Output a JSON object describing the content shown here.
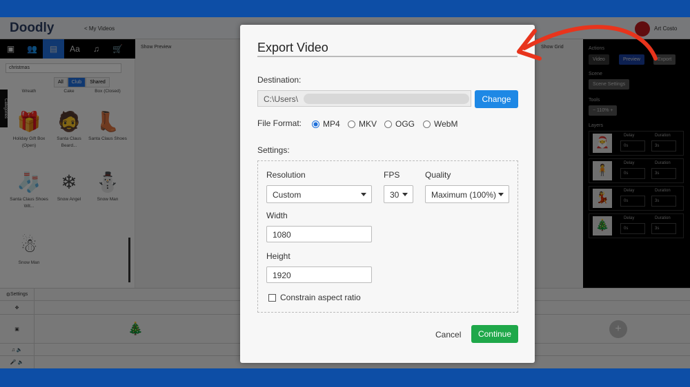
{
  "app": {
    "logo": "Doodly",
    "back_link": "< My Videos",
    "user_name": "Art Costo",
    "search_value": "christmas",
    "filters": [
      "All",
      "Club",
      "Shared"
    ],
    "categories_tab": "Categories",
    "show_preview": "Show Preview",
    "show_grid": "Show Grid",
    "assets": [
      {
        "label": "Wreath"
      },
      {
        "label": "Cake"
      },
      {
        "label": "Box (Closed)"
      },
      {
        "label": "Holiday Gift Box (Open)",
        "icon": "🎁"
      },
      {
        "label": "Santa Claus Beard...",
        "icon": "🧔"
      },
      {
        "label": "Santa Claus Shoes",
        "icon": "👢"
      },
      {
        "label": "Santa Claus Shoes Wit...",
        "icon": "🧦"
      },
      {
        "label": "Snow Angel",
        "icon": "❄"
      },
      {
        "label": "Snow Man",
        "icon": "⛄"
      },
      {
        "label": "Snow Man",
        "icon": "☃"
      }
    ],
    "right_panel": {
      "actions_label": "Actions",
      "video_select": "Video",
      "preview": "Preview",
      "export": "Export",
      "scene_label": "Scene",
      "scene_settings": "Scene Settings",
      "tools_label": "Tools",
      "zoom": "110%",
      "layers_label": "Layers",
      "delay_label": "Delay",
      "duration_label": "Duration",
      "layers": [
        {
          "delay": "0s",
          "duration": "3s"
        },
        {
          "delay": "0s",
          "duration": "3s"
        },
        {
          "delay": "0s",
          "duration": "3s"
        },
        {
          "delay": "0s",
          "duration": "3s"
        }
      ]
    },
    "timeline": {
      "settings": "Settings"
    }
  },
  "dialog": {
    "title": "Export Video",
    "destination_label": "Destination:",
    "destination_value": "C:\\Users\\",
    "change": "Change",
    "file_format_label": "File Format:",
    "formats": [
      "MP4",
      "MKV",
      "OGG",
      "WebM"
    ],
    "selected_format": "MP4",
    "settings_label": "Settings:",
    "resolution_label": "Resolution",
    "resolution_value": "Custom",
    "fps_label": "FPS",
    "fps_value": "30",
    "quality_label": "Quality",
    "quality_value": "Maximum (100%)",
    "width_label": "Width",
    "width_value": "1080",
    "height_label": "Height",
    "height_value": "1920",
    "constrain_label": "Constrain aspect ratio",
    "constrain_checked": false,
    "cancel": "Cancel",
    "continue": "Continue"
  },
  "colors": {
    "frame": "#0d4ea6",
    "primary": "#1e88e5",
    "success": "#1fa84a",
    "annotation_arrow": "#e8341c"
  }
}
